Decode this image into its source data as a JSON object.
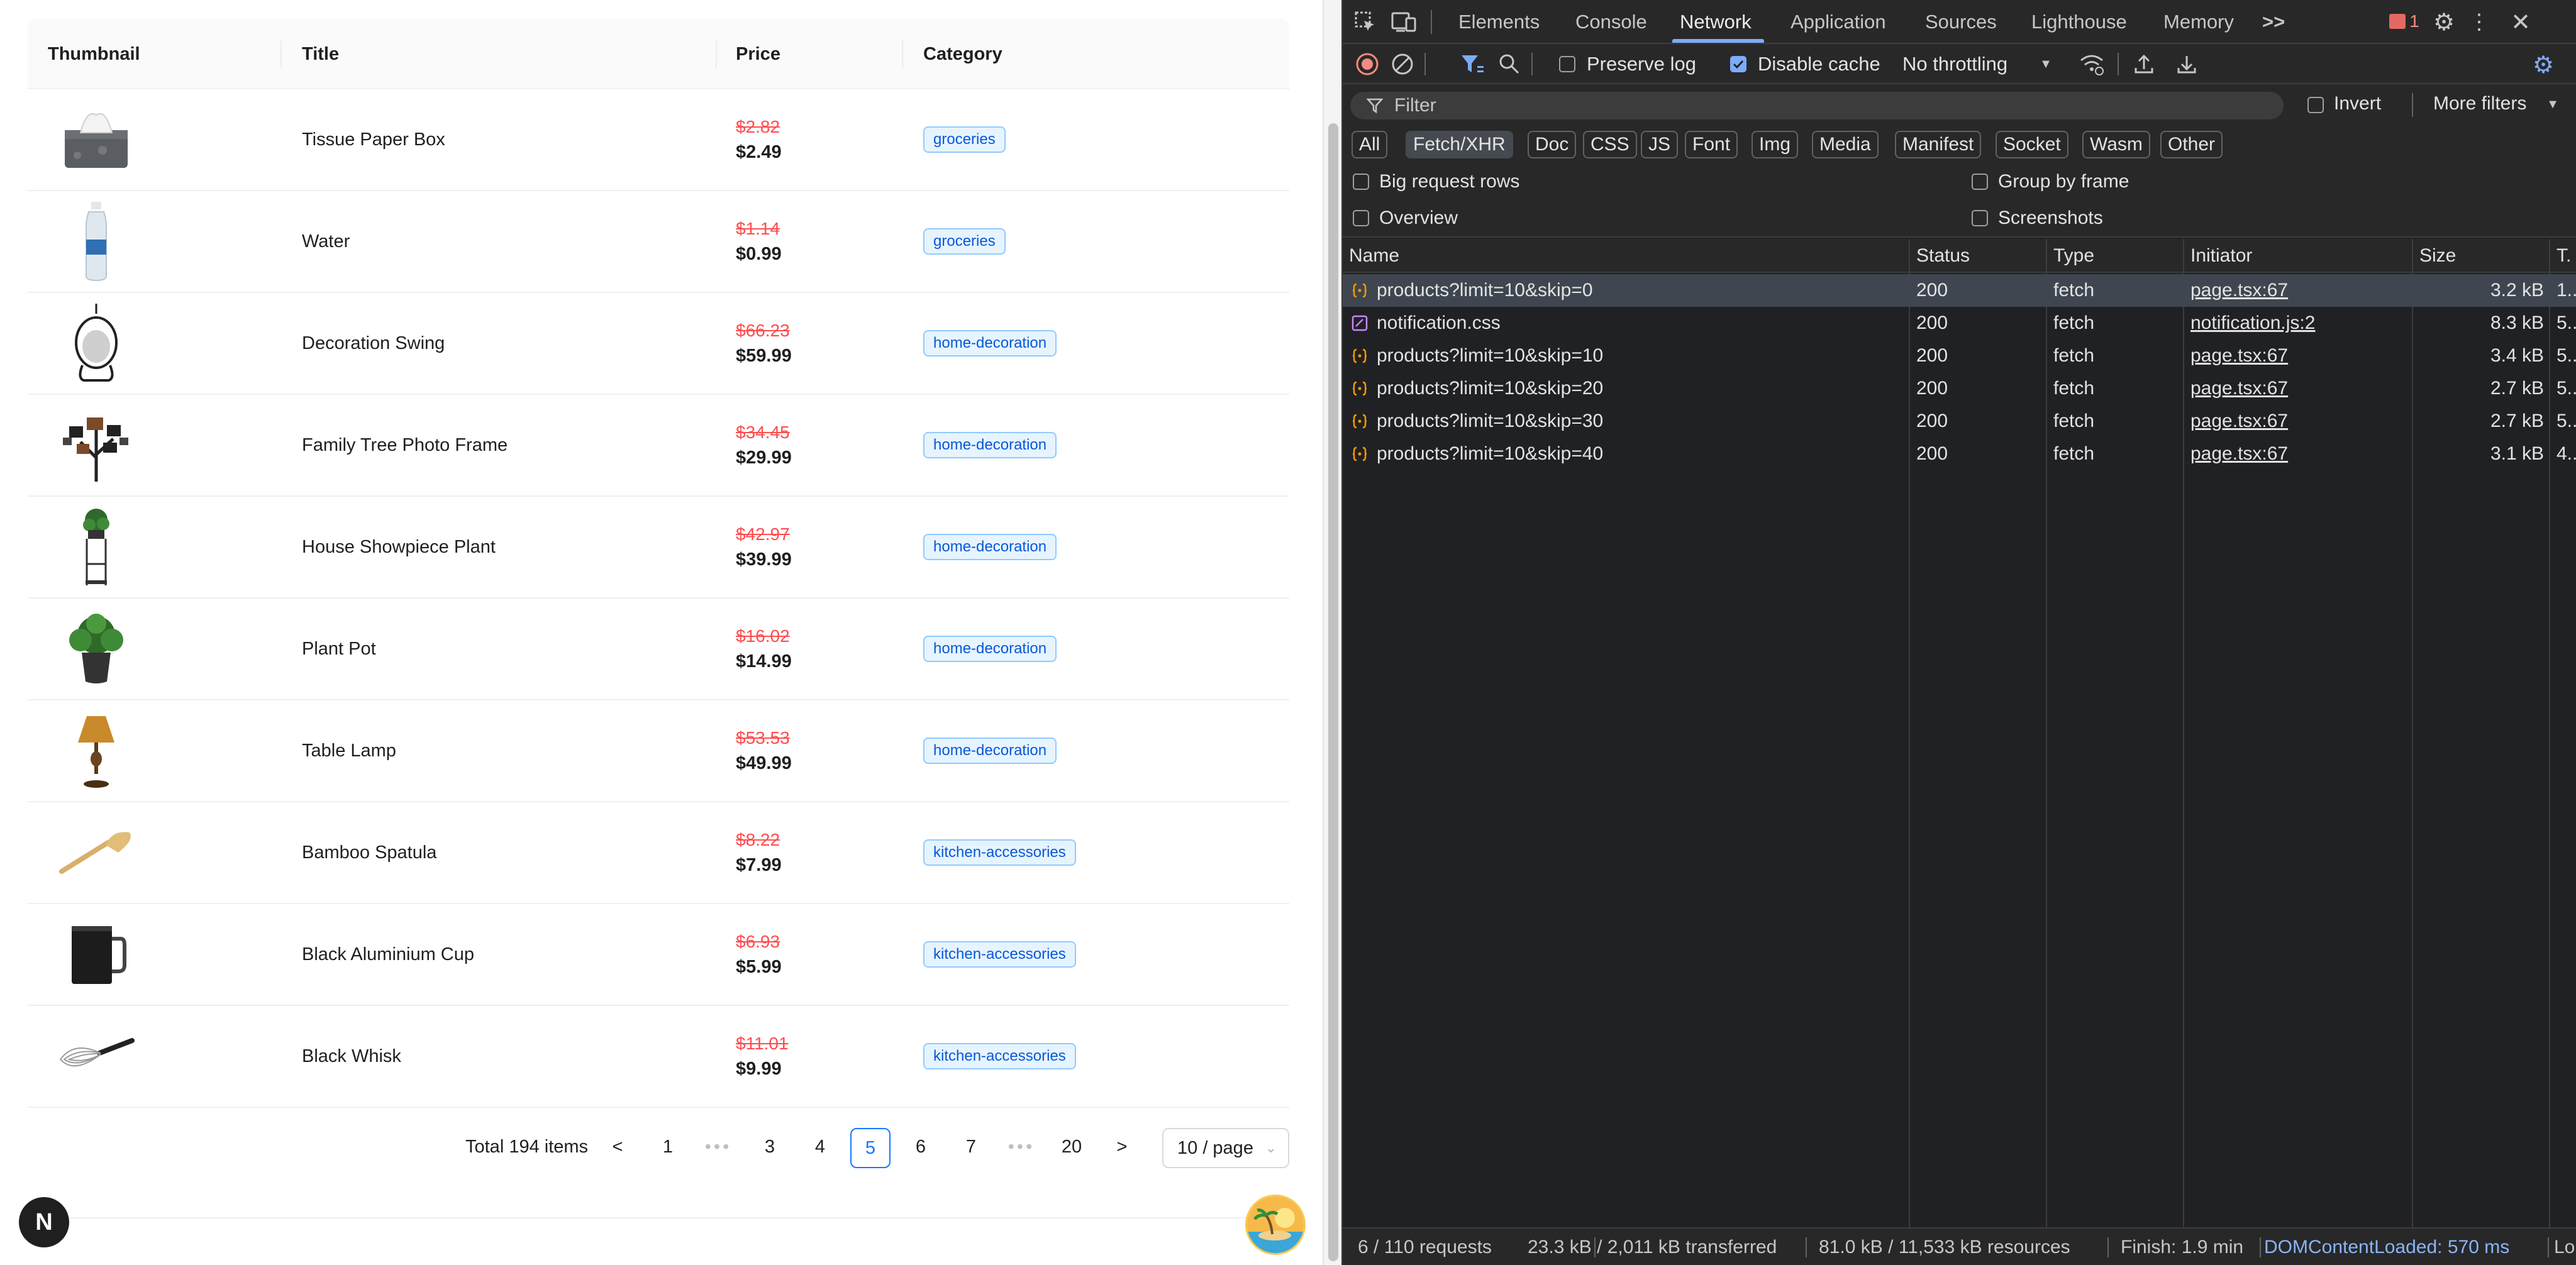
{
  "table": {
    "headers": [
      "Thumbnail",
      "Title",
      "Price",
      "Category"
    ],
    "rows": [
      {
        "title": "Tissue Paper Box",
        "old_price": "$2.82",
        "price": "$2.49",
        "category": "groceries",
        "thumb": "tissue-box"
      },
      {
        "title": "Water",
        "old_price": "$1.14",
        "price": "$0.99",
        "category": "groceries",
        "thumb": "water-bottle"
      },
      {
        "title": "Decoration Swing",
        "old_price": "$66.23",
        "price": "$59.99",
        "category": "home-decoration",
        "thumb": "swing-chair"
      },
      {
        "title": "Family Tree Photo Frame",
        "old_price": "$34.45",
        "price": "$29.99",
        "category": "home-decoration",
        "thumb": "photo-tree"
      },
      {
        "title": "House Showpiece Plant",
        "old_price": "$42.97",
        "price": "$39.99",
        "category": "home-decoration",
        "thumb": "plant-stand"
      },
      {
        "title": "Plant Pot",
        "old_price": "$16.02",
        "price": "$14.99",
        "category": "home-decoration",
        "thumb": "plant-pot"
      },
      {
        "title": "Table Lamp",
        "old_price": "$53.53",
        "price": "$49.99",
        "category": "home-decoration",
        "thumb": "table-lamp"
      },
      {
        "title": "Bamboo Spatula",
        "old_price": "$8.22",
        "price": "$7.99",
        "category": "kitchen-accessories",
        "thumb": "spatula"
      },
      {
        "title": "Black Aluminium Cup",
        "old_price": "$6.93",
        "price": "$5.99",
        "category": "kitchen-accessories",
        "thumb": "black-cup"
      },
      {
        "title": "Black Whisk",
        "old_price": "$11.01",
        "price": "$9.99",
        "category": "kitchen-accessories",
        "thumb": "whisk"
      }
    ]
  },
  "pagination": {
    "total": "Total 194 items",
    "prev": "<",
    "next": ">",
    "pages": [
      "1",
      "3",
      "4",
      "5",
      "6",
      "7",
      "20"
    ],
    "current": "5",
    "ellipsis": "•••",
    "page_size": "10 / page"
  },
  "next_logo": "N",
  "devtools": {
    "tabs": [
      "Elements",
      "Console",
      "Network",
      "Application",
      "Sources",
      "Lighthouse",
      "Memory"
    ],
    "active_tab": "Network",
    "more_tabs": ">>",
    "error_count": "1",
    "toolbar": {
      "preserve_log": "Preserve log",
      "disable_cache": "Disable cache",
      "throttling": "No throttling"
    },
    "filter": {
      "placeholder": "Filter",
      "invert": "Invert",
      "more_filters": "More filters"
    },
    "type_filters": [
      "All",
      "Fetch/XHR",
      "Doc",
      "CSS",
      "JS",
      "Font",
      "Img",
      "Media",
      "Manifest",
      "Socket",
      "Wasm",
      "Other"
    ],
    "active_type": "Fetch/XHR",
    "options": {
      "big_request_rows": "Big request rows",
      "overview": "Overview",
      "group_by_frame": "Group by frame",
      "screenshots": "Screenshots"
    },
    "columns": [
      "Name",
      "Status",
      "Type",
      "Initiator",
      "Size",
      "T."
    ],
    "requests": [
      {
        "name": "products?limit=10&skip=0",
        "status": "200",
        "type": "fetch",
        "initiator": "page.tsx:67",
        "size": "3.2 kB",
        "time": "1..",
        "kind": "fetch"
      },
      {
        "name": "notification.css",
        "status": "200",
        "type": "fetch",
        "initiator": "notification.js:2",
        "size": "8.3 kB",
        "time": "5..",
        "kind": "css"
      },
      {
        "name": "products?limit=10&skip=10",
        "status": "200",
        "type": "fetch",
        "initiator": "page.tsx:67",
        "size": "3.4 kB",
        "time": "5..",
        "kind": "fetch"
      },
      {
        "name": "products?limit=10&skip=20",
        "status": "200",
        "type": "fetch",
        "initiator": "page.tsx:67",
        "size": "2.7 kB",
        "time": "5..",
        "kind": "fetch"
      },
      {
        "name": "products?limit=10&skip=30",
        "status": "200",
        "type": "fetch",
        "initiator": "page.tsx:67",
        "size": "2.7 kB",
        "time": "5..",
        "kind": "fetch"
      },
      {
        "name": "products?limit=10&skip=40",
        "status": "200",
        "type": "fetch",
        "initiator": "page.tsx:67",
        "size": "3.1 kB",
        "time": "4..",
        "kind": "fetch"
      }
    ],
    "status_bar": {
      "requests": "6 / 110 requests",
      "transferred": "23.3 kB / 2,011 kB transferred",
      "resources": "81.0 kB / 11,533 kB resources",
      "finish": "Finish: 1.9 min",
      "dom_loaded": "DOMContentLoaded: 570 ms",
      "load": "Lo"
    },
    "colors": {
      "accent": "#7cacf8",
      "dom_loaded": "#8ab4f8",
      "record": "#f28b82",
      "fetch_icon": "#f29900",
      "css_icon": "#c58af9"
    }
  }
}
